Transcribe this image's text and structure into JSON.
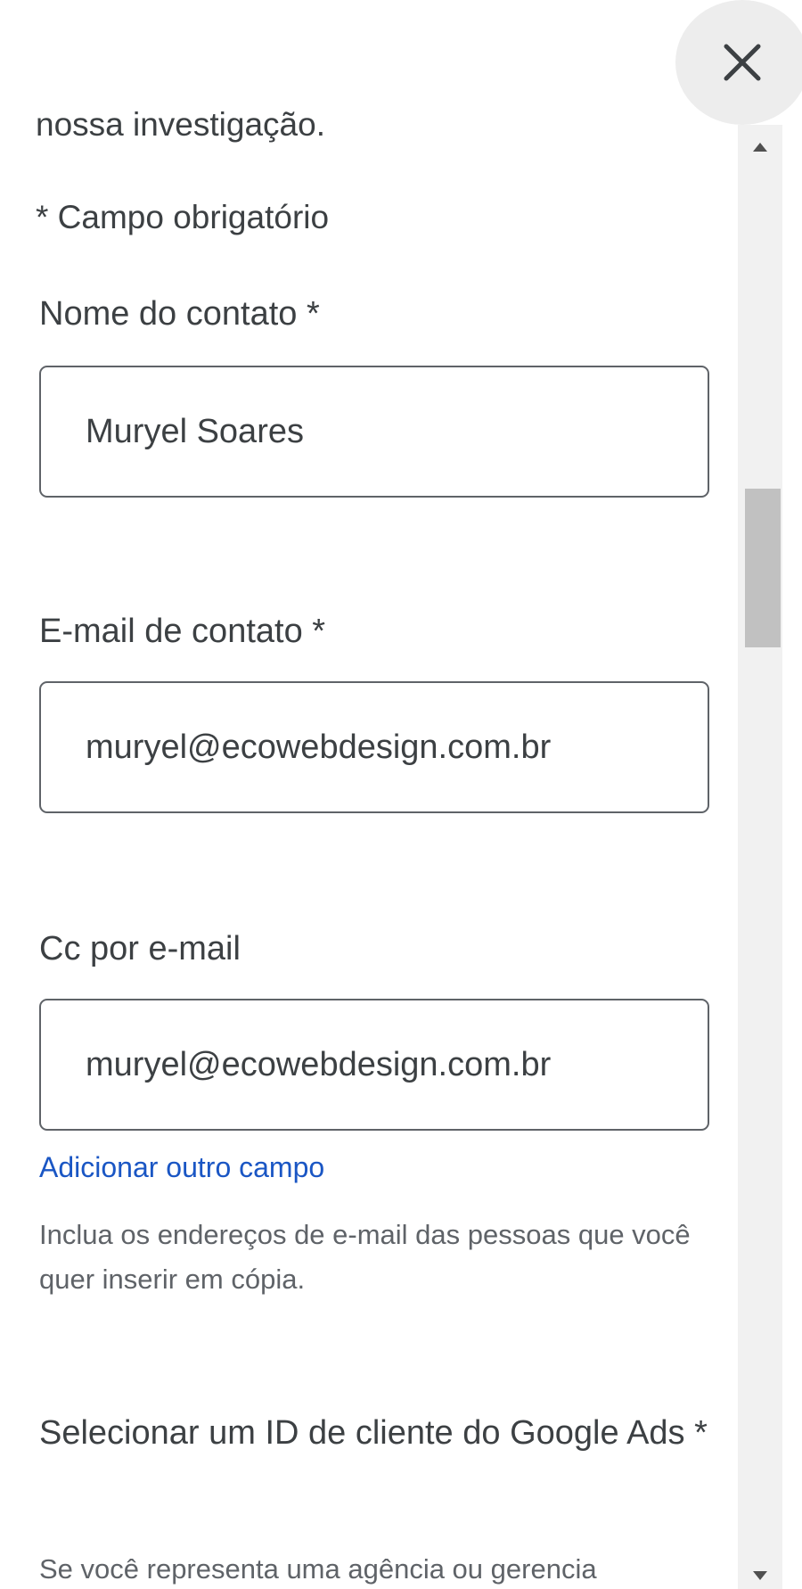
{
  "intro": {
    "cut_text": "nossa investigação.",
    "required_note": "* Campo obrigatório"
  },
  "fields": {
    "contact_name": {
      "label": "Nome do contato *",
      "value": "Muryel Soares"
    },
    "contact_email": {
      "label": "E-mail de contato *",
      "value": "muryel@ecowebdesign.com.br"
    },
    "cc_email": {
      "label": "Cc por e-mail",
      "value": "muryel@ecowebdesign.com.br"
    }
  },
  "add_field_link": "Adicionar outro campo",
  "cc_help": "Inclua os endereços de e-mail das pessoas que você quer inserir em cópia.",
  "ads_select": {
    "label": "Selecionar um ID de cliente do Google Ads *",
    "help_cut": "Se você representa uma agência ou gerencia"
  },
  "close_button": {
    "icon": "close-icon"
  },
  "colors": {
    "link": "#1a56c4",
    "text": "#3c4043",
    "border": "#5f6368"
  },
  "scroll": {
    "position": 0.25
  }
}
